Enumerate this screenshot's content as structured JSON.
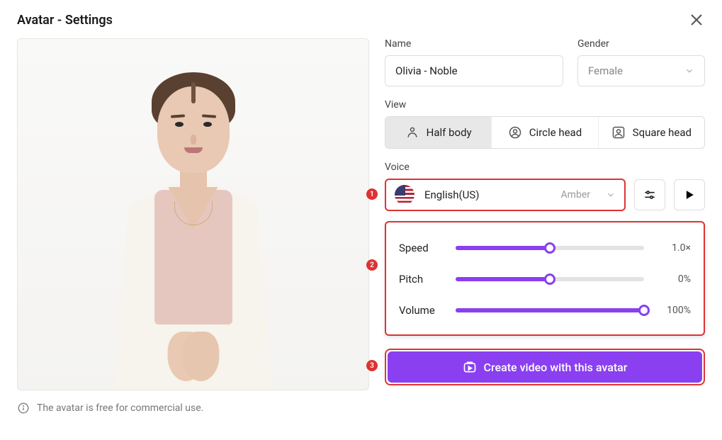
{
  "title": "Avatar - Settings",
  "info_text": "The avatar is free for commercial use.",
  "labels": {
    "name": "Name",
    "gender": "Gender",
    "view": "View",
    "voice": "Voice"
  },
  "name_value": "Olivia - Noble",
  "gender_value": "Female",
  "view_options": {
    "half_body": "Half body",
    "circle_head": "Circle head",
    "square_head": "Square head"
  },
  "voice": {
    "language": "English(US)",
    "voice_name": "Amber"
  },
  "sliders": {
    "speed": {
      "label": "Speed",
      "value_text": "1.0×",
      "percent": 50
    },
    "pitch": {
      "label": "Pitch",
      "value_text": "0%",
      "percent": 50
    },
    "volume": {
      "label": "Volume",
      "value_text": "100%",
      "percent": 100
    }
  },
  "create_button": "Create video with this avatar",
  "annotations": {
    "a1": "1",
    "a2": "2",
    "a3": "3"
  },
  "colors": {
    "accent": "#8a3ff0",
    "highlight_border": "#d33"
  }
}
